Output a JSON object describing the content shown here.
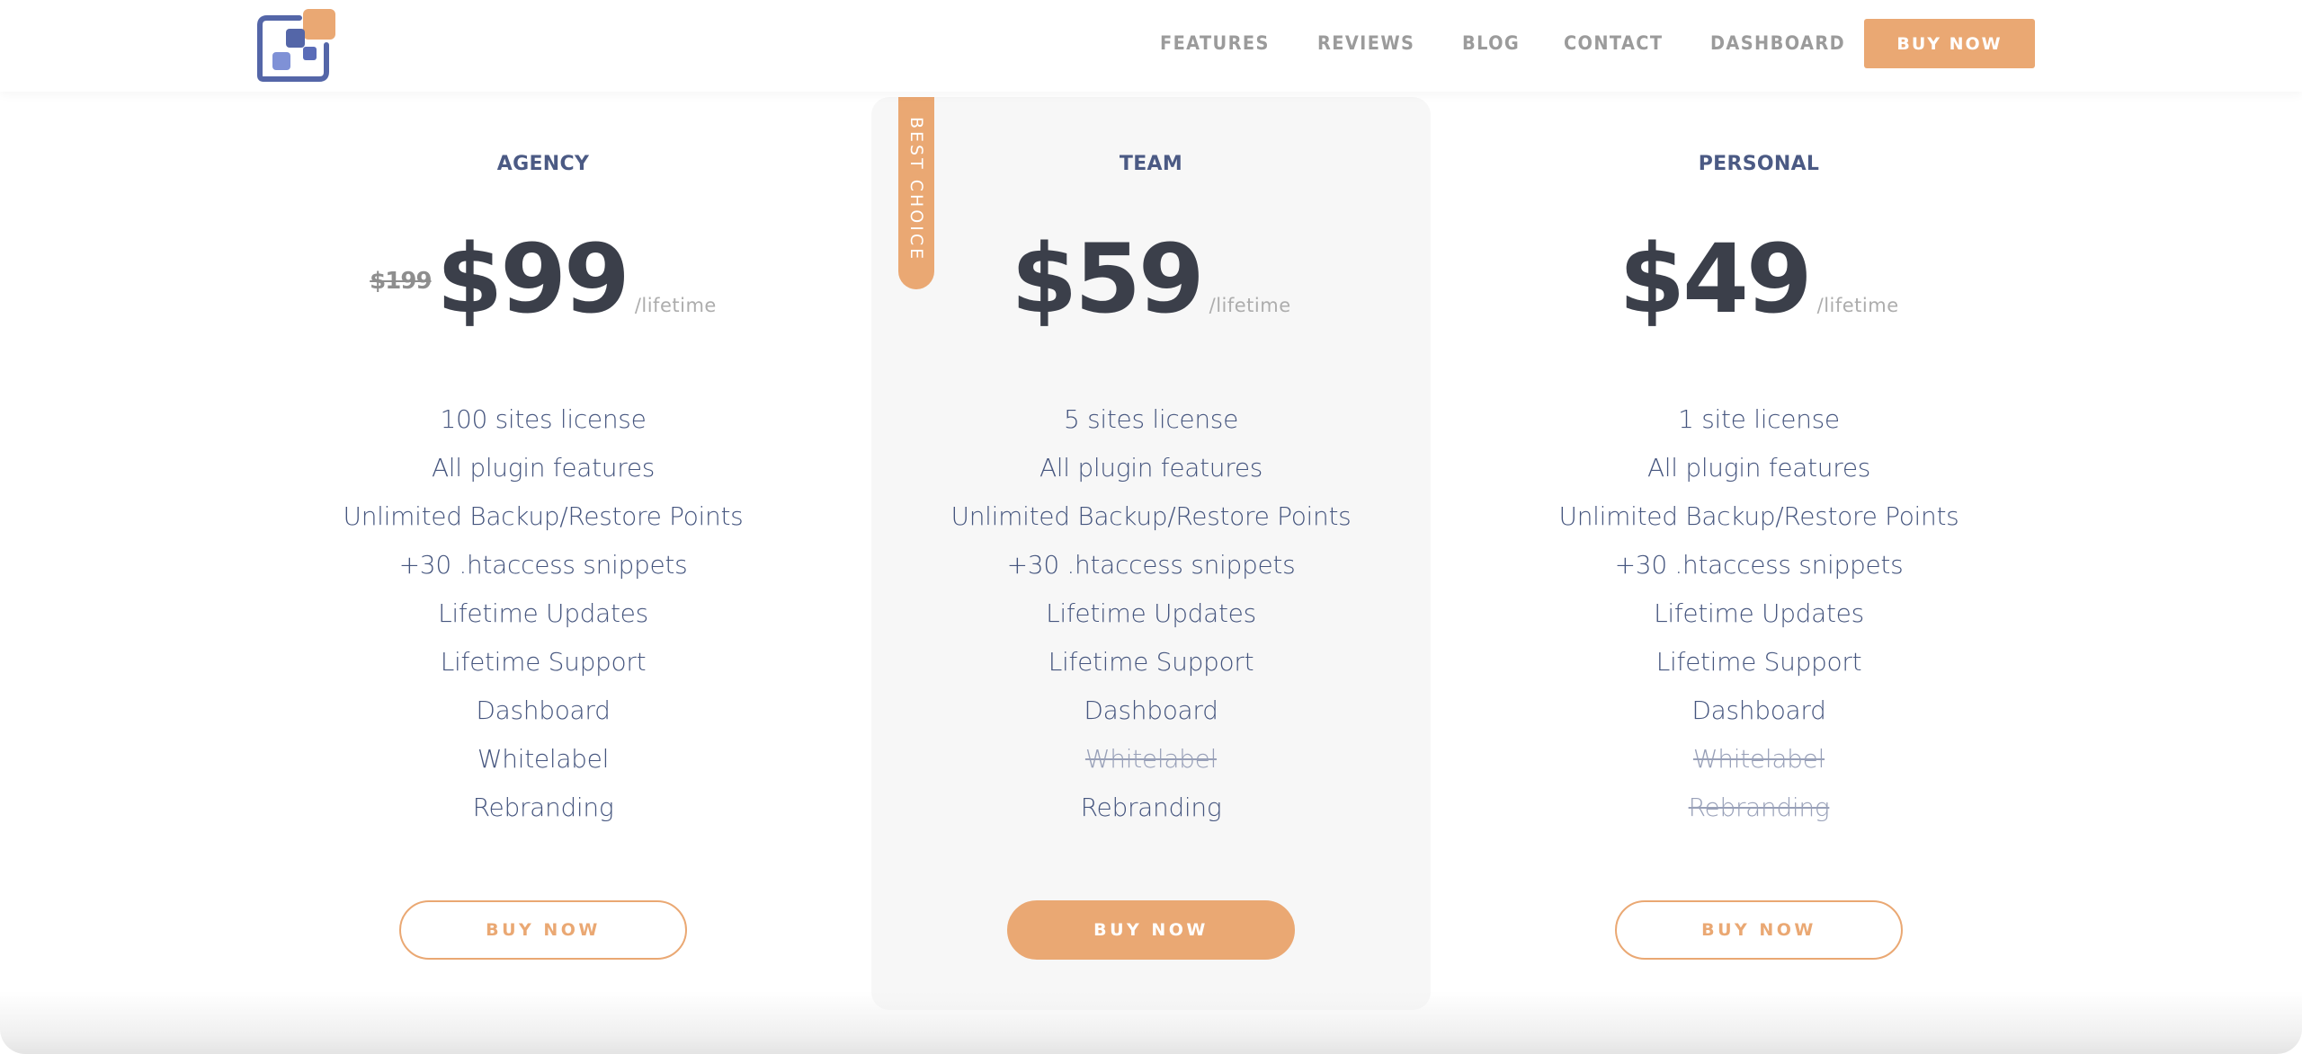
{
  "header": {
    "logo_name": "app-logo",
    "nav": [
      {
        "label": "FEATURES"
      },
      {
        "label": "REVIEWS"
      },
      {
        "label": "BLOG"
      },
      {
        "label": "CONTACT"
      },
      {
        "label": "DASHBOARD"
      }
    ],
    "buy_label": "BUY NOW"
  },
  "colors": {
    "accent": "#eaa873",
    "plan_title": "#4b5a84",
    "price": "#3b3f4a",
    "feature_text": "#45557e",
    "feature_disabled": "#98a0b8",
    "highlight_bg": "#f7f7f7"
  },
  "plans": [
    {
      "name": "AGENCY",
      "old_price": "$199",
      "price": "$99",
      "period": "/lifetime",
      "features": [
        {
          "label": "100 sites license",
          "included": true
        },
        {
          "label": "All plugin features",
          "included": true
        },
        {
          "label": "Unlimited Backup/Restore Points",
          "included": true
        },
        {
          "label": "+30 .htaccess snippets",
          "included": true
        },
        {
          "label": "Lifetime Updates",
          "included": true
        },
        {
          "label": "Lifetime Support",
          "included": true
        },
        {
          "label": "Dashboard",
          "included": true
        },
        {
          "label": "Whitelabel",
          "included": true
        },
        {
          "label": "Rebranding",
          "included": true
        }
      ],
      "buy_label": "BUY NOW"
    },
    {
      "name": "TEAM",
      "badge": "BEST CHOICE",
      "price": "$59",
      "period": "/lifetime",
      "features": [
        {
          "label": "5 sites license",
          "included": true
        },
        {
          "label": "All plugin features",
          "included": true
        },
        {
          "label": "Unlimited Backup/Restore Points",
          "included": true
        },
        {
          "label": "+30 .htaccess snippets",
          "included": true
        },
        {
          "label": "Lifetime Updates",
          "included": true
        },
        {
          "label": "Lifetime Support",
          "included": true
        },
        {
          "label": "Dashboard",
          "included": true
        },
        {
          "label": "Whitelabel",
          "included": false
        },
        {
          "label": "Rebranding",
          "included": true
        }
      ],
      "buy_label": "BUY NOW"
    },
    {
      "name": "PERSONAL",
      "price": "$49",
      "period": "/lifetime",
      "features": [
        {
          "label": "1 site license",
          "included": true
        },
        {
          "label": "All plugin features",
          "included": true
        },
        {
          "label": "Unlimited Backup/Restore Points",
          "included": true
        },
        {
          "label": "+30 .htaccess snippets",
          "included": true
        },
        {
          "label": "Lifetime Updates",
          "included": true
        },
        {
          "label": "Lifetime Support",
          "included": true
        },
        {
          "label": "Dashboard",
          "included": true
        },
        {
          "label": "Whitelabel",
          "included": false
        },
        {
          "label": "Rebranding",
          "included": false
        }
      ],
      "buy_label": "BUY NOW"
    }
  ]
}
